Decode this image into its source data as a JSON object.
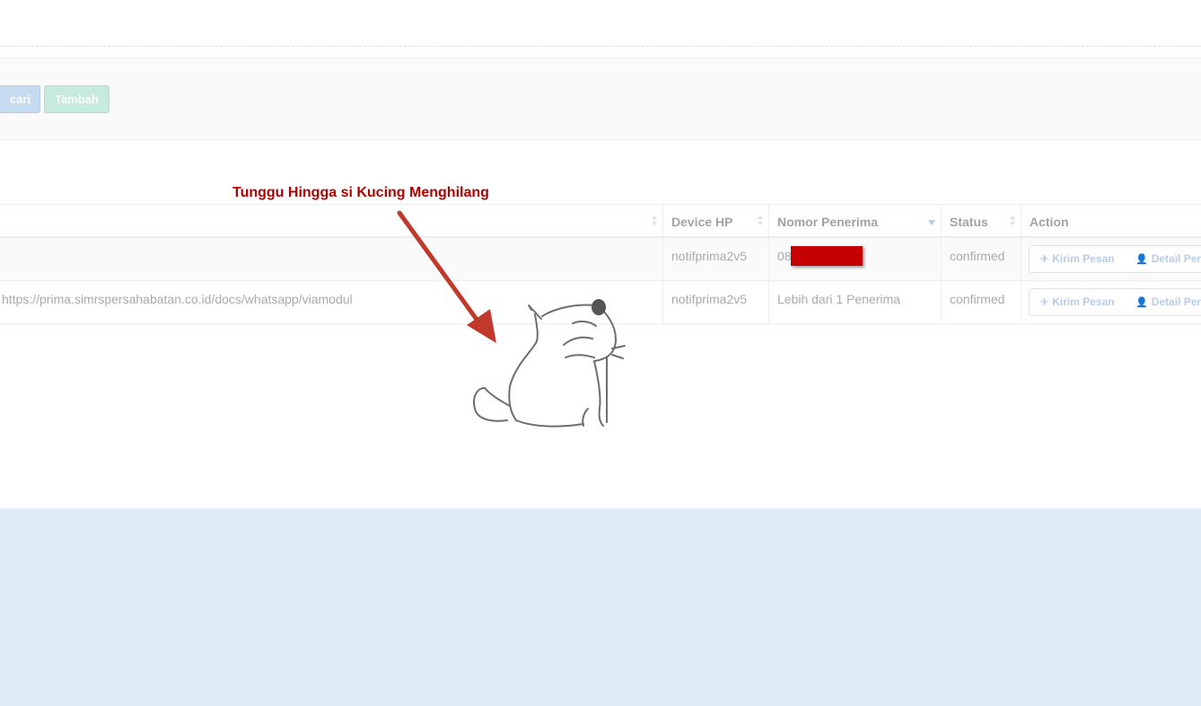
{
  "toolbar": {
    "search_button": "cari",
    "add_button": "Tambah"
  },
  "annotation": {
    "text": "Tunggu Hingga si Kucing Menghilang",
    "color": "#b50000"
  },
  "table": {
    "headers": {
      "col0": "",
      "device": "Device HP",
      "recipient": "Nomor Penerima",
      "status": "Status",
      "action": "Action"
    },
    "rows": [
      {
        "col0": "",
        "device": "notifprima2v5",
        "recipient": "08",
        "status": "confirmed",
        "send": "Kirim Pesan",
        "detail": "Detail Pen"
      },
      {
        "col0": "https://prima.simrspersahabatan.co.id/docs/whatsapp/viamodul",
        "device": "notifprima2v5",
        "recipient": "Lebih dari 1 Penerima",
        "status": "confirmed",
        "send": "Kirim Pesan",
        "detail": "Detail Pen"
      }
    ]
  },
  "colors": {
    "accent_blue": "#c4dbf0",
    "accent_green": "#c6eadb",
    "redaction": "#c40000",
    "footer_bg": "#dfeaf7"
  },
  "icons": {
    "send": "paper-plane-icon",
    "detail": "user-icon",
    "loader": "cat-loader-icon"
  }
}
